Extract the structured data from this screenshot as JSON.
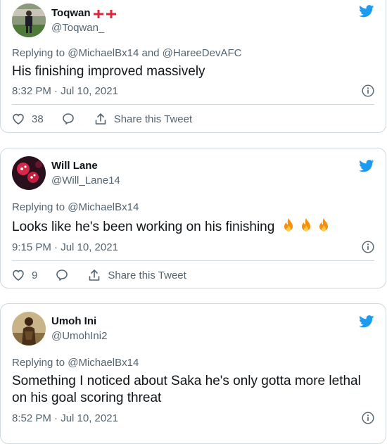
{
  "tweets": [
    {
      "name": "Toqwan",
      "handle": "@Toqwan_",
      "flags": [
        "england-flag-icon",
        "england-flag-icon"
      ],
      "replying_prefix": "Replying to ",
      "replying_to": "@MichaelBx14 and @HareeDevAFC",
      "text": "His finishing improved massively",
      "timestamp": "8:32 PM · Jul 10, 2021",
      "likes": "38",
      "share_label": "Share this Tweet"
    },
    {
      "name": "Will Lane",
      "handle": "@Will_Lane14",
      "replying_prefix": "Replying to ",
      "replying_to": "@MichaelBx14",
      "text": "Looks like he's been working on his finishing",
      "emoji": [
        "fire-icon",
        "fire-icon",
        "fire-icon"
      ],
      "timestamp": "9:15 PM · Jul 10, 2021",
      "likes": "9",
      "share_label": "Share this Tweet"
    },
    {
      "name": "Umoh Ini",
      "handle": "@UmohIni2",
      "replying_prefix": "Replying to ",
      "replying_to": "@MichaelBx14",
      "text": "Something I noticed about Saka he's only gotta more lethal on his goal scoring threat",
      "timestamp": "8:52 PM · Jul 10, 2021"
    }
  ],
  "colors": {
    "twitter_blue": "#1d9bf0",
    "muted": "#536471",
    "text": "#0f1419",
    "border": "#cfd9de"
  }
}
